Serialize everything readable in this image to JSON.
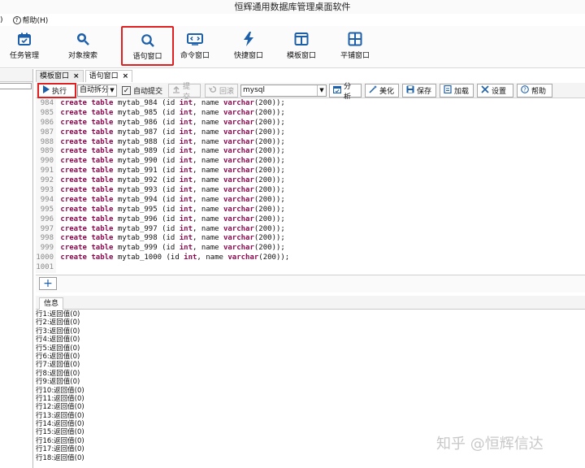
{
  "window": {
    "title": "恒辉通用数据库管理桌面软件"
  },
  "menu": {
    "edge_text": ")",
    "help_label": "帮助(H)",
    "help_icon": "?"
  },
  "ribbon": {
    "items": [
      {
        "label": "任务管理",
        "icon": "calendar-icon"
      },
      {
        "label": "对象搜索",
        "icon": "object-search-icon"
      },
      {
        "label": "语句窗口",
        "icon": "search-icon",
        "active": true
      },
      {
        "label": "命令窗口",
        "icon": "terminal-icon"
      },
      {
        "label": "快捷窗口",
        "icon": "lightning-icon"
      },
      {
        "label": "模板窗口",
        "icon": "template-icon"
      },
      {
        "label": "平铺窗口",
        "icon": "tile-icon"
      }
    ]
  },
  "tabs": [
    {
      "label": "模板窗口",
      "close": "×"
    },
    {
      "label": "语句窗口",
      "close": "×"
    }
  ],
  "toolbar": {
    "execute": "执行",
    "paging": "自动拆分",
    "auto_commit": "自动提交",
    "auto_commit_checked": "✓",
    "commit": "提交",
    "rollback": "回滚",
    "db_type": "mysql",
    "analyze": "分析",
    "beautify": "美化",
    "save": "保存",
    "load": "加载",
    "settings": "设置",
    "help": "帮助"
  },
  "editor": {
    "lines": [
      {
        "no": "984",
        "kw1": "create",
        "kw2": "table",
        "name": "mytab_984",
        "open": " (id ",
        "t1": "int",
        "mid": ", name ",
        "t2": "varchar",
        "tail": "(200));"
      },
      {
        "no": "985",
        "kw1": "create",
        "kw2": "table",
        "name": "mytab_985",
        "open": " (id ",
        "t1": "int",
        "mid": ", name ",
        "t2": "varchar",
        "tail": "(200));"
      },
      {
        "no": "986",
        "kw1": "create",
        "kw2": "table",
        "name": "mytab_986",
        "open": " (id ",
        "t1": "int",
        "mid": ", name ",
        "t2": "varchar",
        "tail": "(200));"
      },
      {
        "no": "987",
        "kw1": "create",
        "kw2": "table",
        "name": "mytab_987",
        "open": " (id ",
        "t1": "int",
        "mid": ", name ",
        "t2": "varchar",
        "tail": "(200));"
      },
      {
        "no": "988",
        "kw1": "create",
        "kw2": "table",
        "name": "mytab_988",
        "open": " (id ",
        "t1": "int",
        "mid": ", name ",
        "t2": "varchar",
        "tail": "(200));"
      },
      {
        "no": "989",
        "kw1": "create",
        "kw2": "table",
        "name": "mytab_989",
        "open": " (id ",
        "t1": "int",
        "mid": ", name ",
        "t2": "varchar",
        "tail": "(200));"
      },
      {
        "no": "990",
        "kw1": "create",
        "kw2": "table",
        "name": "mytab_990",
        "open": " (id ",
        "t1": "int",
        "mid": ", name ",
        "t2": "varchar",
        "tail": "(200));"
      },
      {
        "no": "991",
        "kw1": "create",
        "kw2": "table",
        "name": "mytab_991",
        "open": " (id ",
        "t1": "int",
        "mid": ", name ",
        "t2": "varchar",
        "tail": "(200));"
      },
      {
        "no": "992",
        "kw1": "create",
        "kw2": "table",
        "name": "mytab_992",
        "open": " (id ",
        "t1": "int",
        "mid": ", name ",
        "t2": "varchar",
        "tail": "(200));"
      },
      {
        "no": "993",
        "kw1": "create",
        "kw2": "table",
        "name": "mytab_993",
        "open": " (id ",
        "t1": "int",
        "mid": ", name ",
        "t2": "varchar",
        "tail": "(200));"
      },
      {
        "no": "994",
        "kw1": "create",
        "kw2": "table",
        "name": "mytab_994",
        "open": " (id ",
        "t1": "int",
        "mid": ", name ",
        "t2": "varchar",
        "tail": "(200));"
      },
      {
        "no": "995",
        "kw1": "create",
        "kw2": "table",
        "name": "mytab_995",
        "open": " (id ",
        "t1": "int",
        "mid": ", name ",
        "t2": "varchar",
        "tail": "(200));"
      },
      {
        "no": "996",
        "kw1": "create",
        "kw2": "table",
        "name": "mytab_996",
        "open": " (id ",
        "t1": "int",
        "mid": ", name ",
        "t2": "varchar",
        "tail": "(200));"
      },
      {
        "no": "997",
        "kw1": "create",
        "kw2": "table",
        "name": "mytab_997",
        "open": " (id ",
        "t1": "int",
        "mid": ", name ",
        "t2": "varchar",
        "tail": "(200));"
      },
      {
        "no": "998",
        "kw1": "create",
        "kw2": "table",
        "name": "mytab_998",
        "open": " (id ",
        "t1": "int",
        "mid": ", name ",
        "t2": "varchar",
        "tail": "(200));"
      },
      {
        "no": "999",
        "kw1": "create",
        "kw2": "table",
        "name": "mytab_999",
        "open": " (id ",
        "t1": "int",
        "mid": ", name ",
        "t2": "varchar",
        "tail": "(200));"
      },
      {
        "no": "1000",
        "kw1": "create",
        "kw2": "table",
        "name": "mytab_1000",
        "open": " (id ",
        "t1": "int",
        "mid": ", name ",
        "t2": "varchar",
        "tail": "(200));"
      },
      {
        "no": "1001",
        "kw1": "",
        "kw2": "",
        "name": "",
        "open": "",
        "t1": "",
        "mid": "",
        "t2": "",
        "tail": ""
      }
    ]
  },
  "add_button": "+",
  "info": {
    "tab_label": "信息",
    "lines": [
      "行1:返回值(0)",
      "行2:返回值(0)",
      "行3:返回值(0)",
      "行4:返回值(0)",
      "行5:返回值(0)",
      "行6:返回值(0)",
      "行7:返回值(0)",
      "行8:返回值(0)",
      "行9:返回值(0)",
      "行10:返回值(0)",
      "行11:返回值(0)",
      "行12:返回值(0)",
      "行13:返回值(0)",
      "行14:返回值(0)",
      "行15:返回值(0)",
      "行16:返回值(0)",
      "行17:返回值(0)",
      "行18:返回值(0)"
    ]
  },
  "watermark": "知乎 @恒辉信达",
  "colors": {
    "highlight": "#e02020",
    "keyword": "#8b0a50",
    "icon_blue": "#1d5fa8"
  }
}
